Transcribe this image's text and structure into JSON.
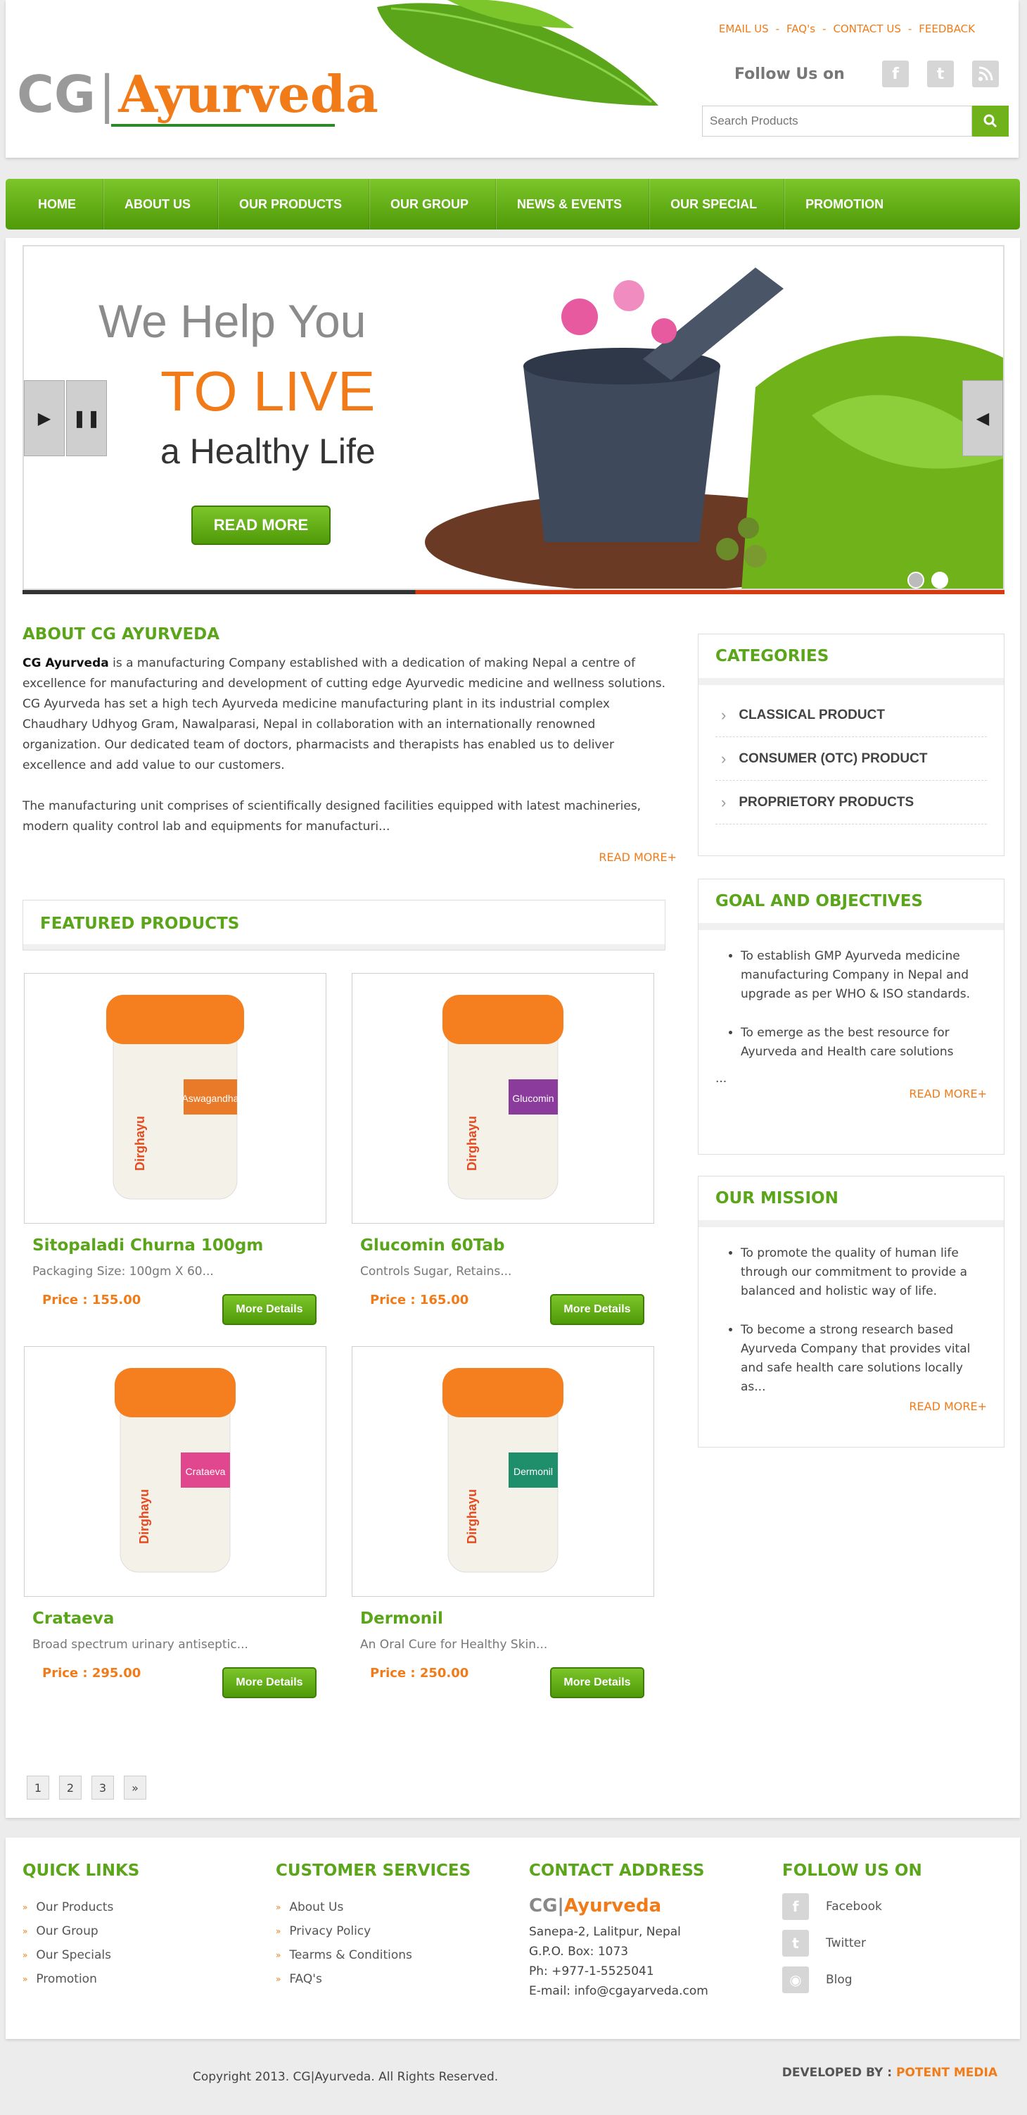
{
  "header": {
    "brand_cg": "CG",
    "brand_bar": "|",
    "brand_ay": "Ayurveda",
    "top_links": [
      "EMAIL US",
      "FAQ's",
      "CONTACT US",
      "FEEDBACK"
    ],
    "separator": "-",
    "follow_label": "Follow Us on",
    "social": [
      "facebook-icon",
      "twitter-icon",
      "rss-icon"
    ],
    "search_placeholder": "Search Products"
  },
  "nav": {
    "items": [
      "HOME",
      "ABOUT US",
      "OUR PRODUCTS",
      "OUR GROUP",
      "NEWS & EVENTS",
      "OUR SPECIAL",
      "PROMOTION"
    ]
  },
  "slider": {
    "line1": "We Help You",
    "line2": "TO LIVE",
    "line3": "a Healthy Life",
    "button": "READ MORE",
    "slide_count": 2,
    "active_slide": 2
  },
  "about": {
    "title": "ABOUT CG AYURVEDA",
    "bold_lead": "CG Ayurveda",
    "para1": " is a manufacturing  Company established with a dedication of making Nepal a centre of excellence for manufacturing and development of cutting edge Ayurvedic medicine and wellness solutions. CG Ayurveda has set a high tech Ayurveda medicine manufacturing plant in its industrial complex Chaudhary Udhyog Gram, Nawalparasi, Nepal in collaboration with an internationally renowned organization. Our dedicated team of doctors, pharmacists and therapists has enabled us to deliver excellence and add value to our customers.",
    "para2": "The manufacturing unit comprises of scientifically designed facilities equipped with latest machineries, modern quality control lab and equipments for manufacturi...",
    "read_more": "READ MORE+"
  },
  "featured": {
    "title": "FEATURED PRODUCTS",
    "products": [
      {
        "name": "Sitopaladi Churna 100gm",
        "desc": "Packaging Size: 100gm X 60...",
        "price": "Price : 155.00",
        "button": "More Details",
        "label": "Aswagandha",
        "label_color": "#e87a2a"
      },
      {
        "name": "Glucomin 60Tab",
        "desc": "Controls Sugar, Retains...",
        "price": "Price : 165.00",
        "button": "More Details",
        "label": "Glucomin",
        "label_color": "#8a3b9c"
      },
      {
        "name": "Crataeva",
        "desc": "Broad spectrum urinary antiseptic...",
        "price": "Price : 295.00",
        "button": "More Details",
        "label": "Crataeva",
        "label_color": "#e0478f"
      },
      {
        "name": "Dermonil",
        "desc": "An Oral Cure for Healthy Skin...",
        "price": "Price : 250.00",
        "button": "More Details",
        "label": "Dermonil",
        "label_color": "#1e8f6a"
      }
    ],
    "jar_brand": "Dirghayu",
    "pages": [
      "1",
      "2",
      "3",
      "»"
    ]
  },
  "sidebar": {
    "categories_title": "CATEGORIES",
    "categories": [
      "CLASSICAL PRODUCT",
      "CONSUMER (OTC) PRODUCT",
      "PROPRIETORY PRODUCTS"
    ],
    "goal_title": "GOAL AND OBJECTIVES",
    "goals": [
      "To establish GMP Ayurveda medicine manufacturing Company in Nepal and upgrade as per WHO & ISO standards.",
      "To emerge as the best resource for Ayurveda and Health care solutions"
    ],
    "goal_ellipsis": "...",
    "goal_more": "READ MORE+",
    "mission_title": "OUR MISSION",
    "missions": [
      "To promote the quality of human life through our commitment to provide a balanced and holistic way of life.",
      "To become a strong research based Ayurveda Company that provides vital and safe health care solutions locally as..."
    ],
    "mission_more": "READ MORE+"
  },
  "footer": {
    "quick_title": "QUICK LINKS",
    "quick_links": [
      "Our Products",
      "Our Group",
      "Our Specials",
      "Promotion"
    ],
    "service_title": "CUSTOMER SERVICES",
    "service_links": [
      "About Us",
      "Privacy Policy",
      "Tearms & Conditions",
      "FAQ's"
    ],
    "contact_title": "CONTACT ADDRESS",
    "contact_logo_cg": "CG",
    "contact_logo_bar": "|",
    "contact_logo_ay": "Ayurveda",
    "address": [
      "Sanepa-2, Lalitpur, Nepal",
      "G.P.O. Box: 1073",
      "Ph: +977-1-5525041",
      "E-mail: info@cgayarveda.com"
    ],
    "follow_title": "FOLLOW US ON",
    "follow_links": [
      "Facebook",
      "Twitter",
      "Blog"
    ],
    "copyright": "Copyright 2013. CG|Ayurveda. All Rights Reserved.",
    "developed_label": "DEVELOPED BY : ",
    "developed_brand": "POTENT MEDIA"
  },
  "colors": {
    "accent_green": "#5aa51a",
    "accent_orange": "#f07b18"
  }
}
